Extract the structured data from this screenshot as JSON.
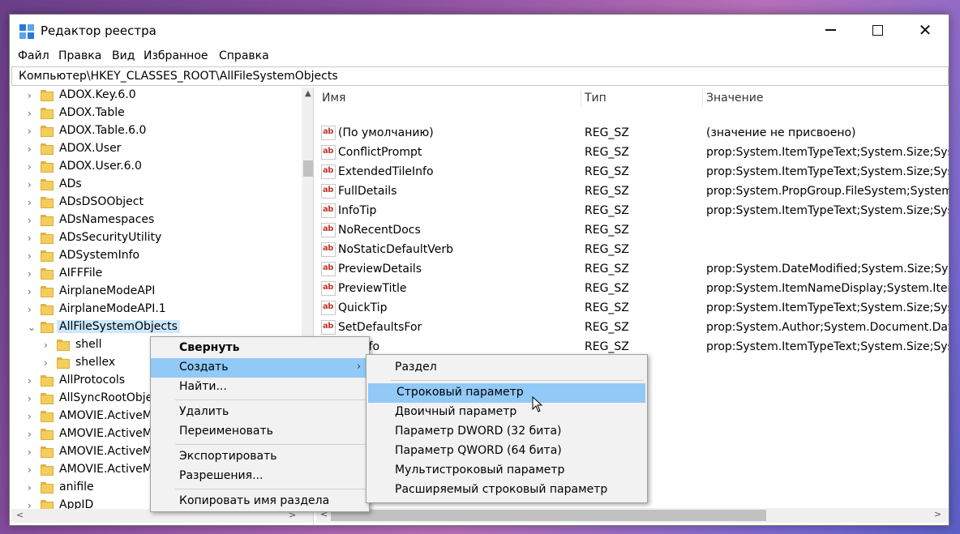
{
  "window": {
    "title": "Редактор реестра",
    "controls": {
      "minimize": "—",
      "maximize": "☐",
      "close": "✕"
    }
  },
  "menu": [
    "Файл",
    "Правка",
    "Вид",
    "Избранное",
    "Справка"
  ],
  "address": "Компьютер\\HKEY_CLASSES_ROOT\\AllFileSystemObjects",
  "tree": [
    {
      "label": "ADOX.Key.6.0",
      "expanded": false,
      "level": 0
    },
    {
      "label": "ADOX.Table",
      "expanded": false,
      "level": 0
    },
    {
      "label": "ADOX.Table.6.0",
      "expanded": false,
      "level": 0
    },
    {
      "label": "ADOX.User",
      "expanded": false,
      "level": 0
    },
    {
      "label": "ADOX.User.6.0",
      "expanded": false,
      "level": 0
    },
    {
      "label": "ADs",
      "expanded": false,
      "level": 0
    },
    {
      "label": "ADsDSOObject",
      "expanded": false,
      "level": 0
    },
    {
      "label": "ADsNamespaces",
      "expanded": false,
      "level": 0
    },
    {
      "label": "ADsSecurityUtility",
      "expanded": false,
      "level": 0
    },
    {
      "label": "ADSystemInfo",
      "expanded": false,
      "level": 0
    },
    {
      "label": "AIFFFile",
      "expanded": false,
      "level": 0
    },
    {
      "label": "AirplaneModeAPI",
      "expanded": false,
      "level": 0
    },
    {
      "label": "AirplaneModeAPI.1",
      "expanded": false,
      "level": 0
    },
    {
      "label": "AllFileSystemObjects",
      "expanded": true,
      "level": 0,
      "selected": true
    },
    {
      "label": "shell",
      "expanded": false,
      "level": 1
    },
    {
      "label": "shellex",
      "expanded": false,
      "level": 1
    },
    {
      "label": "AllProtocols",
      "expanded": false,
      "level": 0
    },
    {
      "label": "AllSyncRootObject",
      "expanded": false,
      "level": 0
    },
    {
      "label": "AMOVIE.ActiveMo",
      "expanded": false,
      "level": 0
    },
    {
      "label": "AMOVIE.ActiveMo",
      "expanded": false,
      "level": 0
    },
    {
      "label": "AMOVIE.ActiveMo",
      "expanded": false,
      "level": 0
    },
    {
      "label": "AMOVIE.ActiveMo",
      "expanded": false,
      "level": 0
    },
    {
      "label": "anifile",
      "expanded": false,
      "level": 0
    },
    {
      "label": "AppID",
      "expanded": false,
      "level": 0
    }
  ],
  "columns": {
    "name": "Имя",
    "type": "Тип",
    "value": "Значение"
  },
  "values": [
    {
      "name": "(По умолчанию)",
      "type": "REG_SZ",
      "value": "(значение не присвоено)"
    },
    {
      "name": "ConflictPrompt",
      "type": "REG_SZ",
      "value": "prop:System.ItemTypeText;System.Size;Systen"
    },
    {
      "name": "ExtendedTileInfo",
      "type": "REG_SZ",
      "value": "prop:System.ItemTypeText;System.Size;Systen"
    },
    {
      "name": "FullDetails",
      "type": "REG_SZ",
      "value": "prop:System.PropGroup.FileSystem;System.Ite"
    },
    {
      "name": "InfoTip",
      "type": "REG_SZ",
      "value": "prop:System.ItemTypeText;System.Size;Systen"
    },
    {
      "name": "NoRecentDocs",
      "type": "REG_SZ",
      "value": ""
    },
    {
      "name": "NoStaticDefaultVerb",
      "type": "REG_SZ",
      "value": ""
    },
    {
      "name": "PreviewDetails",
      "type": "REG_SZ",
      "value": "prop:System.DateModified;System.Size;Syster"
    },
    {
      "name": "PreviewTitle",
      "type": "REG_SZ",
      "value": "prop:System.ItemNameDisplay;System.ItemTy"
    },
    {
      "name": "QuickTip",
      "type": "REG_SZ",
      "value": "prop:System.ItemTypeText;System.Size;Systen"
    },
    {
      "name": "SetDefaultsFor",
      "type": "REG_SZ",
      "value": "prop:System.Author;System.Document.DateC"
    },
    {
      "name": "TileInfo",
      "type": "REG_SZ",
      "value": "prop:System.ItemTypeText;System.Size;Systen"
    }
  ],
  "context_menu": {
    "collapse": "Свернуть",
    "create": "Создать",
    "find": "Найти...",
    "delete": "Удалить",
    "rename": "Переименовать",
    "export": "Экспортировать",
    "permissions": "Разрешения...",
    "copy_key_name": "Копировать имя раздела"
  },
  "submenu": {
    "key": "Раздел",
    "string_value": "Строковый параметр",
    "binary_value": "Двоичный параметр",
    "dword_value": "Параметр DWORD (32 бита)",
    "qword_value": "Параметр QWORD (64 бита)",
    "multi_string_value": "Мультистроковый параметр",
    "expandable_string_value": "Расширяемый строковый параметр"
  },
  "icons": {
    "app": "registry-editor-icon",
    "folder": "folder-icon",
    "value": "string-value-icon",
    "cursor": "mouse-pointer-icon"
  },
  "colors": {
    "selection": "#cce8ff",
    "menu_highlight": "#91c9f7",
    "folder": "#f5cd5a",
    "value_icon_text": "#c0392b"
  }
}
